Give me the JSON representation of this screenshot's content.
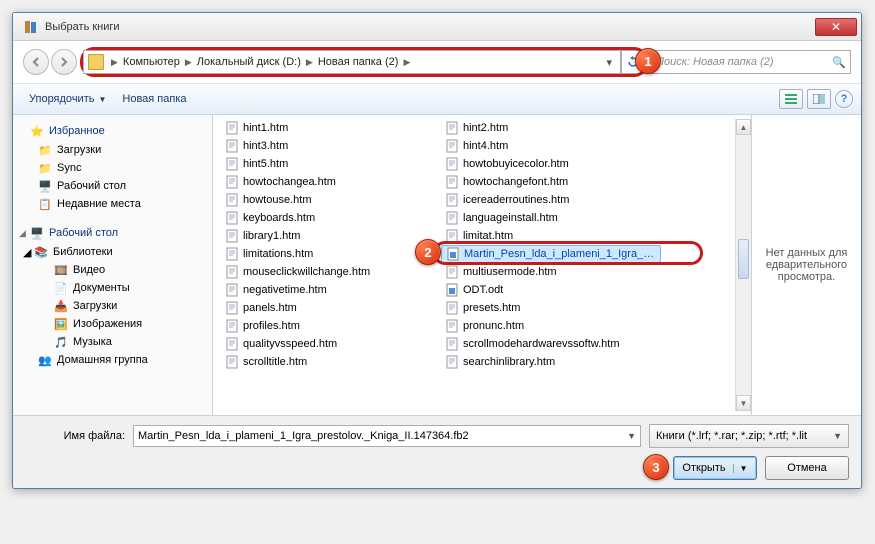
{
  "window": {
    "title": "Выбрать книги"
  },
  "breadcrumb": {
    "items": [
      "Компьютер",
      "Локальный диск (D:)",
      "Новая папка (2)"
    ]
  },
  "search": {
    "placeholder": "Поиск: Новая папка (2)"
  },
  "toolbar": {
    "organize": "Упорядочить",
    "new_folder": "Новая папка"
  },
  "sidebar": {
    "favorites": {
      "label": "Избранное",
      "items": [
        "Загрузки",
        "Sync",
        "Рабочий стол",
        "Недавние места"
      ]
    },
    "desktop": {
      "label": "Рабочий стол",
      "libraries": {
        "label": "Библиотеки",
        "items": [
          "Видео",
          "Документы",
          "Загрузки",
          "Изображения",
          "Музыка"
        ]
      },
      "homegroup": "Домашняя группа"
    }
  },
  "files": {
    "col1": [
      "hint1.htm",
      "hint3.htm",
      "hint5.htm",
      "howtochangea.htm",
      "howtouse.htm",
      "keyboards.htm",
      "library1.htm",
      "limitations.htm",
      "mouseclickwillchange.htm",
      "negativetime.htm",
      "panels.htm",
      "profiles.htm",
      "qualityvsspeed.htm",
      "scrolltitle.htm"
    ],
    "col2": [
      "hint2.htm",
      "hint4.htm",
      "howtobuyicecolor.htm",
      "howtochangefont.htm",
      "icereaderroutines.htm",
      "languageinstall.htm",
      "limitat.htm",
      "Martin_Pesn_lda_i_plameni_1_Igra_p...",
      "multiusermode.htm",
      "ODT.odt",
      "presets.htm",
      "pronunc.htm",
      "scrollmodehardwarevssoftw.htm",
      "searchinlibrary.htm"
    ],
    "selected_index": 7
  },
  "preview": {
    "empty_text": "Нет данных для едварительного просмотра."
  },
  "footer": {
    "filename_label": "Имя файла:",
    "filename_value": "Martin_Pesn_lda_i_plameni_1_Igra_prestolov._Kniga_II.147364.fb2",
    "filter": "Книги (*.lrf; *.rar; *.zip; *.rtf; *.lit",
    "open": "Открыть",
    "cancel": "Отмена"
  },
  "badges": {
    "b1": "1",
    "b2": "2",
    "b3": "3"
  }
}
